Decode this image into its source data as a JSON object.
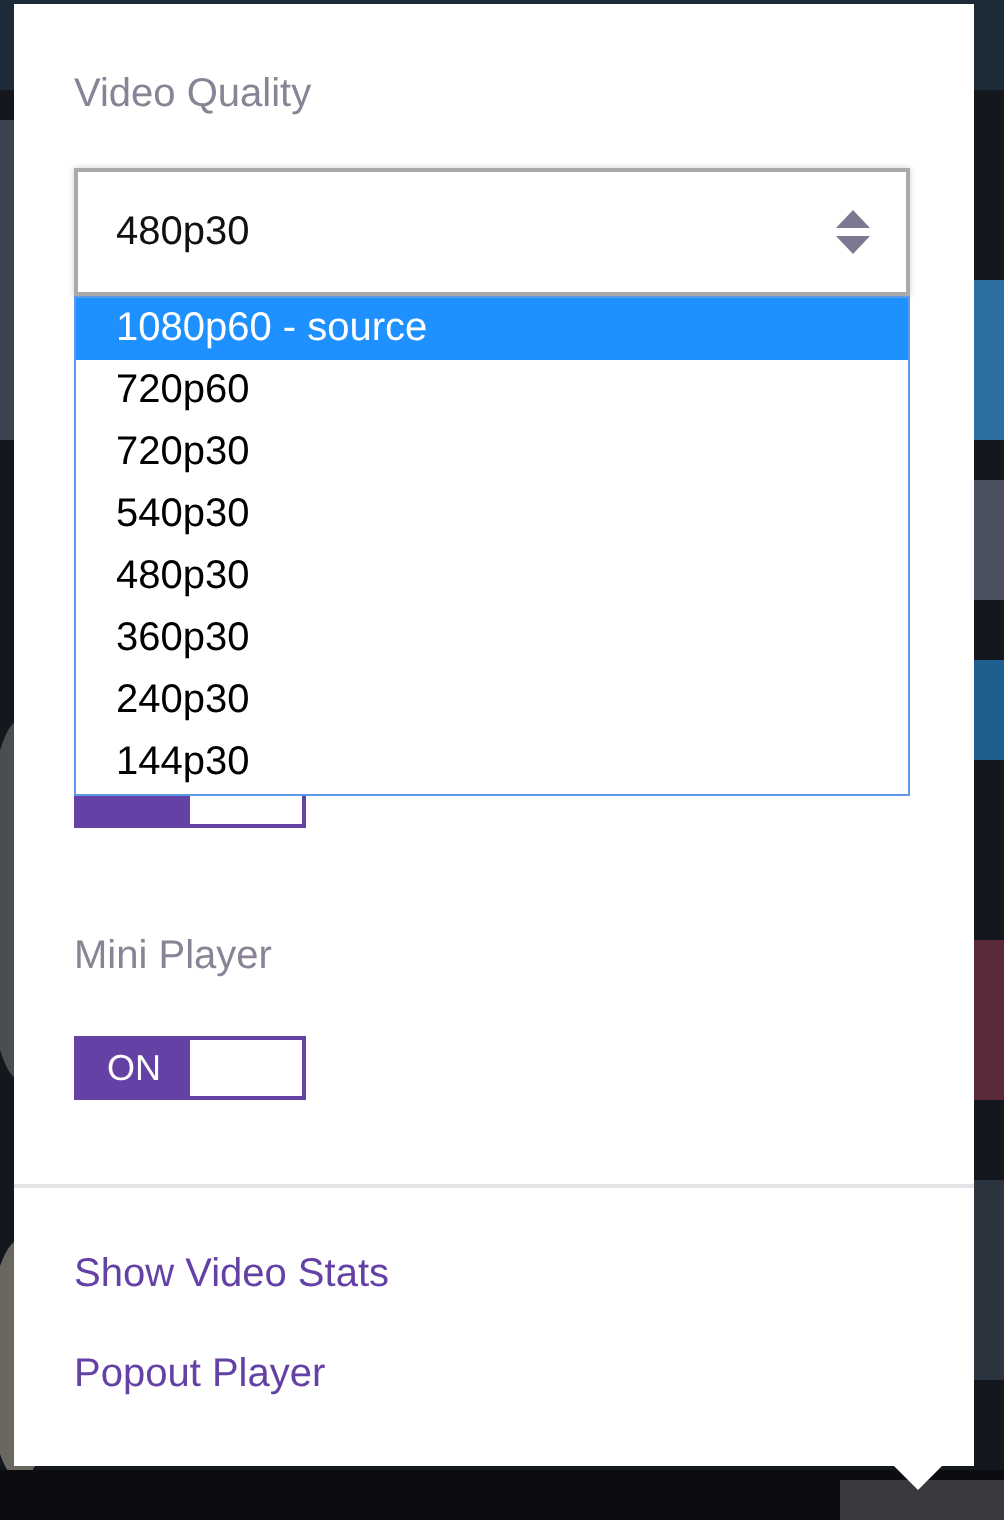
{
  "quality": {
    "label": "Video Quality",
    "value": "480p30",
    "expanded": true,
    "options": [
      {
        "label": "1080p60 - source",
        "highlighted": true
      },
      {
        "label": "720p60",
        "highlighted": false
      },
      {
        "label": "720p30",
        "highlighted": false
      },
      {
        "label": "540p30",
        "highlighted": false
      },
      {
        "label": "480p30",
        "highlighted": false
      },
      {
        "label": "360p30",
        "highlighted": false
      },
      {
        "label": "240p30",
        "highlighted": false
      },
      {
        "label": "144p30",
        "highlighted": false
      }
    ]
  },
  "settings": [
    {
      "kind": "toggle",
      "on": true
    },
    {
      "kind": "toggle",
      "label": "Mini Player",
      "on": true,
      "text": "ON"
    }
  ],
  "links": [
    "Show Video Stats",
    "Popout Player"
  ]
}
